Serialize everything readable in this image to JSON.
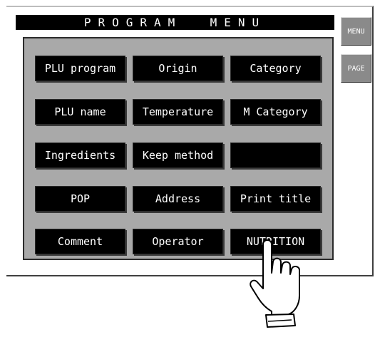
{
  "header": {
    "title": "PROGRAM  MENU"
  },
  "side": {
    "menu_label": "MENU",
    "page_label": "PAGE"
  },
  "menu": {
    "items": [
      [
        "PLU program",
        "Origin",
        "Category"
      ],
      [
        "PLU name",
        "Temperature",
        "M Category"
      ],
      [
        "Ingredients",
        "Keep method",
        ""
      ],
      [
        "POP",
        "Address",
        "Print title"
      ],
      [
        "Comment",
        "Operator",
        "NUTRITION"
      ]
    ]
  },
  "pointer": {
    "icon": "pointing-hand-icon",
    "target": "NUTRITION"
  }
}
